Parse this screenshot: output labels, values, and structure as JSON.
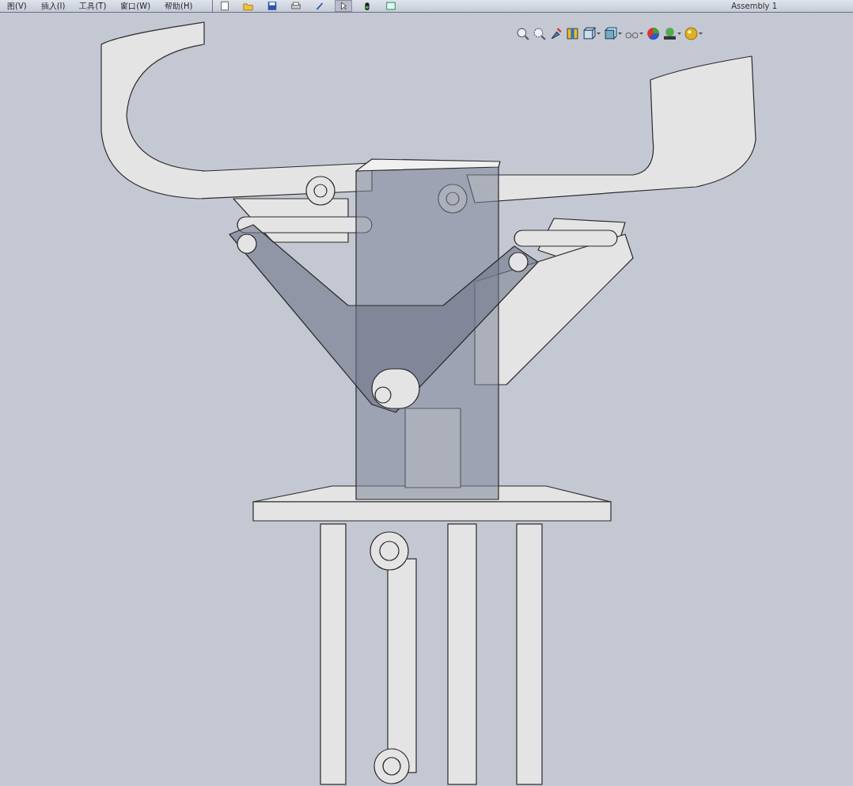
{
  "menu": [
    {
      "label": "图(V)"
    },
    {
      "label": "插入(I)"
    },
    {
      "label": "工具(T)"
    },
    {
      "label": "窗口(W)"
    },
    {
      "label": "帮助(H)"
    }
  ],
  "toolbar": [
    {
      "kind": "new"
    },
    {
      "kind": "open"
    },
    {
      "kind": "save"
    },
    {
      "kind": "print"
    },
    {
      "kind": "undo"
    },
    {
      "kind": "select",
      "selected": true
    },
    {
      "kind": "rebuild"
    },
    {
      "kind": "options"
    }
  ],
  "document_title": "Assembly 1",
  "view_toolbar": [
    {
      "kind": "zoom-fit",
      "dropdown": false
    },
    {
      "kind": "zoom-area",
      "dropdown": false
    },
    {
      "kind": "previous-view",
      "dropdown": false
    },
    {
      "kind": "section",
      "dropdown": false
    },
    {
      "kind": "view-orientation",
      "dropdown": true
    },
    {
      "kind": "display-style",
      "dropdown": true
    },
    {
      "kind": "hide-show",
      "dropdown": true
    },
    {
      "kind": "appearance",
      "dropdown": false
    },
    {
      "kind": "scene",
      "dropdown": true
    },
    {
      "kind": "render",
      "dropdown": true
    }
  ]
}
